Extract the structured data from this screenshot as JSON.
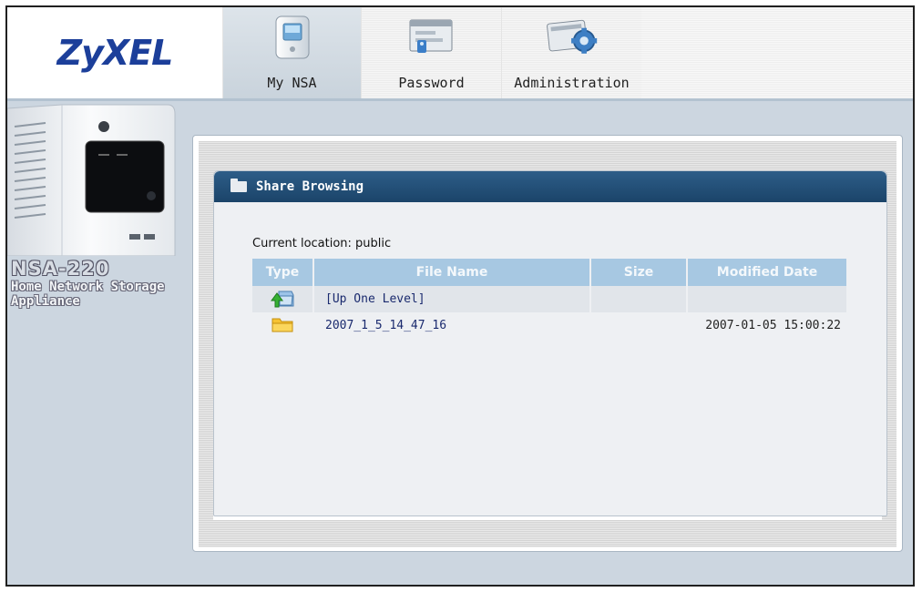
{
  "header": {
    "logo_text": "ZyXEL",
    "nav": [
      {
        "label": "My NSA",
        "icon": "nas-device-icon"
      },
      {
        "label": "Password",
        "icon": "password-icon"
      },
      {
        "label": "Administration",
        "icon": "administration-gear-icon"
      }
    ]
  },
  "device": {
    "model": "NSA-220",
    "subtitle_line1": "Home Network Storage",
    "subtitle_line2": "Appliance"
  },
  "panel": {
    "title": "Share Browsing",
    "current_location": "Current location: public"
  },
  "table": {
    "columns": [
      "Type",
      "File Name",
      "Size",
      "Modified Date"
    ],
    "rows": [
      {
        "type_icon": "up-level-icon",
        "name": "[Up One Level]",
        "size": "",
        "modified": ""
      },
      {
        "type_icon": "folder-icon",
        "name": "2007_1_5_14_47_16",
        "size": "",
        "modified": "2007-01-05 15:00:22"
      }
    ]
  },
  "colors": {
    "brand_blue": "#1c3f9a",
    "title_bar": "#1b4469",
    "table_header": "#a7c8e2",
    "background": "#ccd6e0"
  }
}
